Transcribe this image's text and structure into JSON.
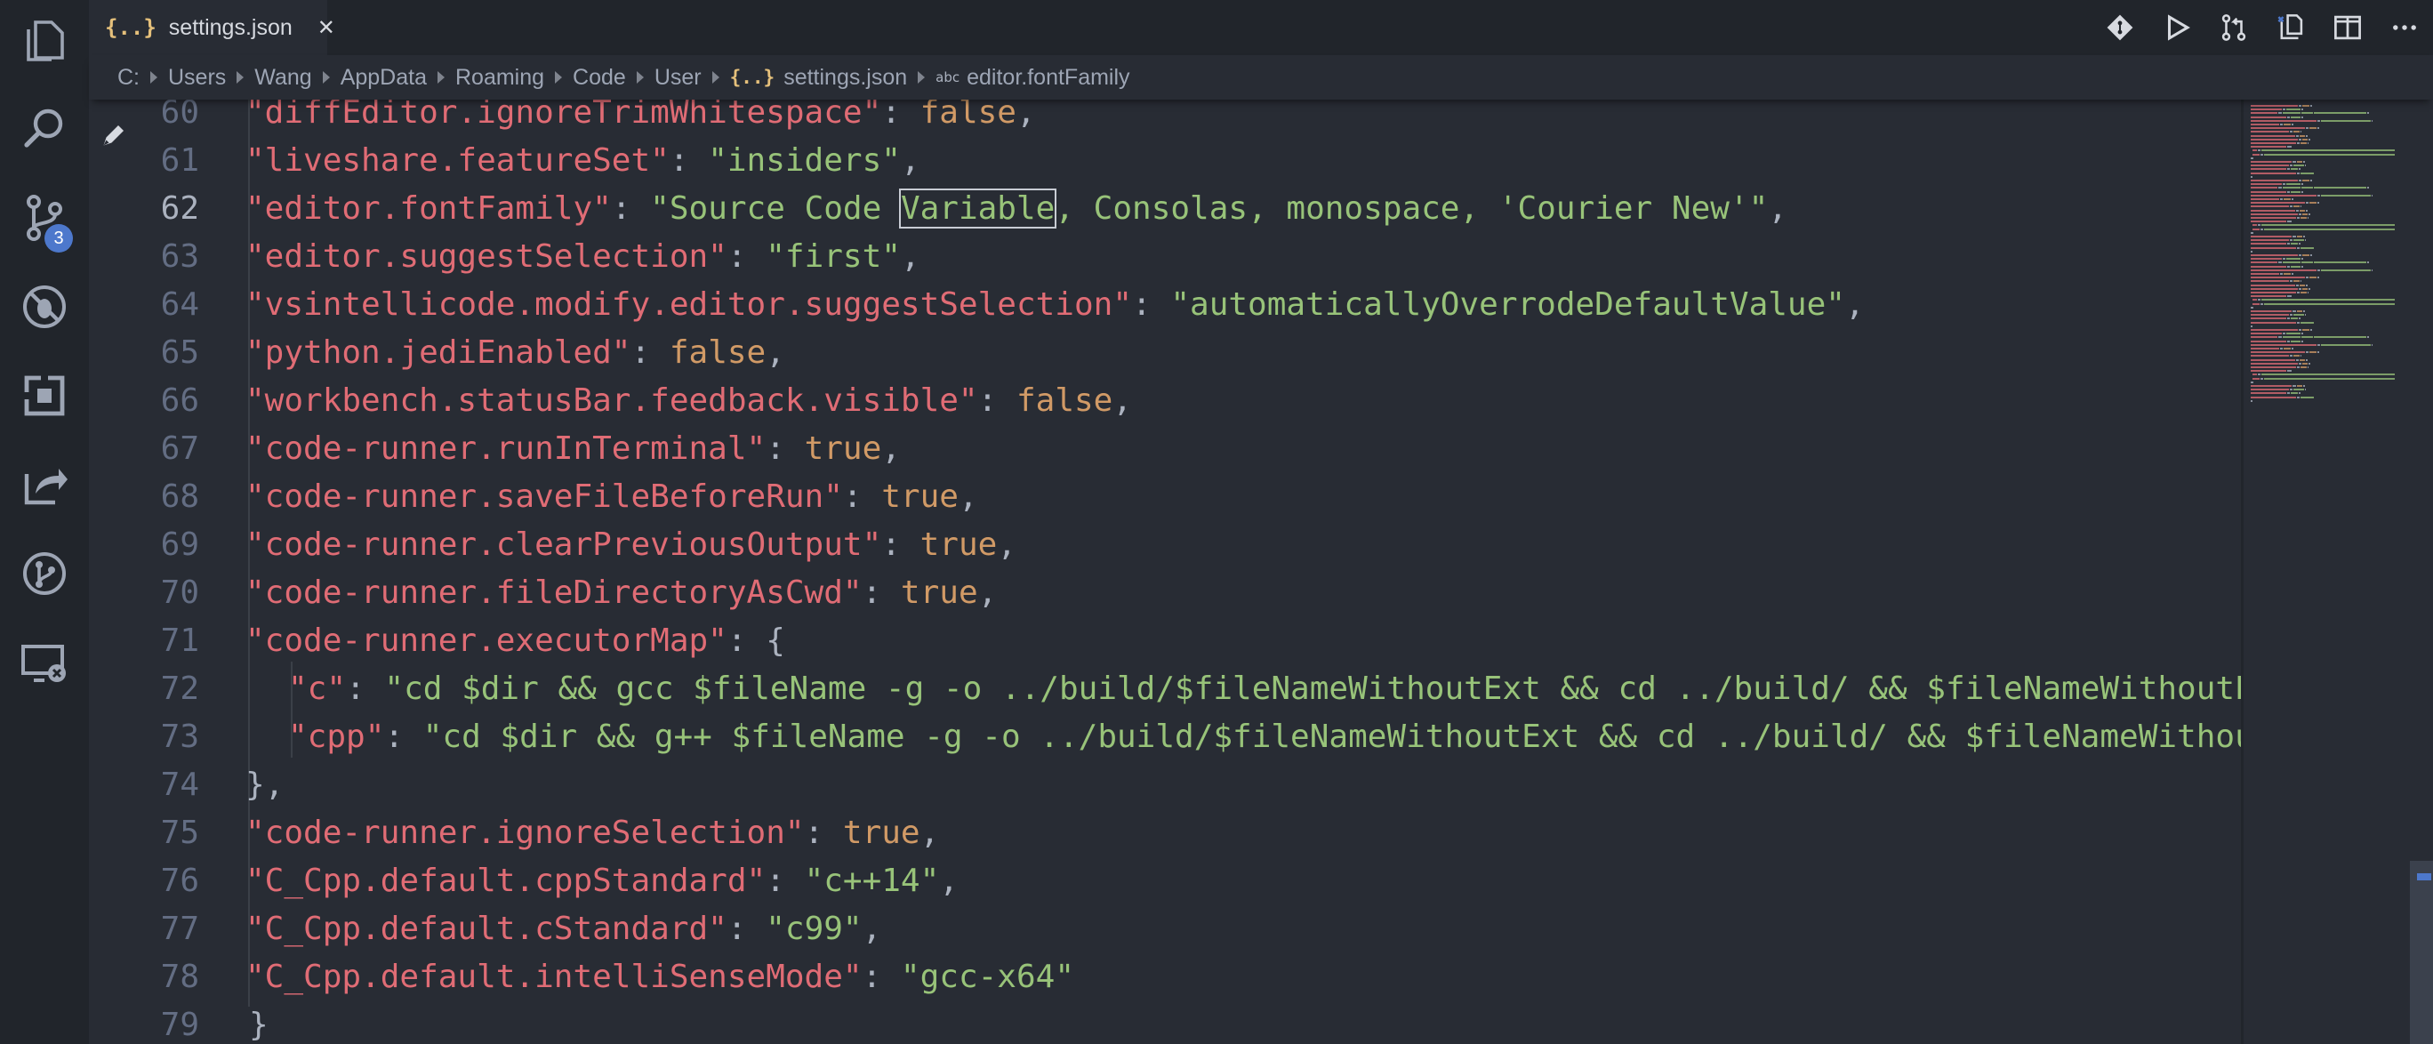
{
  "tab": {
    "icon": "json-braces-icon",
    "glyph": "{..}",
    "label": "settings.json",
    "close_glyph": "✕"
  },
  "breadcrumb": {
    "segments": [
      "C:",
      "Users",
      "Wang",
      "AppData",
      "Roaming",
      "Code",
      "User",
      "settings.json",
      "editor.fontFamily"
    ],
    "json_glyph": "{..}",
    "abc_glyph": "abc"
  },
  "activity_bar": {
    "items": [
      {
        "name": "explorer-icon"
      },
      {
        "name": "search-icon"
      },
      {
        "name": "source-control-icon"
      },
      {
        "name": "debug-icon"
      },
      {
        "name": "extensions-icon"
      },
      {
        "name": "live-share-icon"
      },
      {
        "name": "git-graph-icon"
      },
      {
        "name": "remote-explorer-icon"
      }
    ],
    "scm_badge": "3"
  },
  "editor_actions": [
    "git-compare-icon",
    "run-icon",
    "pull-request-icon",
    "open-changes-icon",
    "split-editor-icon",
    "more-actions-icon"
  ],
  "editor": {
    "current_line": "62",
    "lines": [
      {
        "num": "60",
        "tokens": [
          {
            "t": "k",
            "v": "\"diffEditor.ignoreTrimWhitespace\""
          },
          {
            "t": "p",
            "v": ": "
          },
          {
            "t": "n",
            "v": "false"
          },
          {
            "t": "p",
            "v": ","
          }
        ]
      },
      {
        "num": "61",
        "tokens": [
          {
            "t": "k",
            "v": "\"liveshare.featureSet\""
          },
          {
            "t": "p",
            "v": ": "
          },
          {
            "t": "s",
            "v": "\"insiders\""
          },
          {
            "t": "p",
            "v": ","
          }
        ]
      },
      {
        "num": "62",
        "tokens": [
          {
            "t": "k",
            "v": "\"editor.fontFamily\""
          },
          {
            "t": "p",
            "v": ": "
          },
          {
            "t": "s",
            "v": "\"Source Code "
          },
          {
            "t": "hl",
            "v": "Variable"
          },
          {
            "t": "s",
            "v": ", Consolas, monospace, 'Courier New'\""
          },
          {
            "t": "p",
            "v": ","
          }
        ]
      },
      {
        "num": "63",
        "tokens": [
          {
            "t": "k",
            "v": "\"editor.suggestSelection\""
          },
          {
            "t": "p",
            "v": ": "
          },
          {
            "t": "s",
            "v": "\"first\""
          },
          {
            "t": "p",
            "v": ","
          }
        ]
      },
      {
        "num": "64",
        "tokens": [
          {
            "t": "k",
            "v": "\"vsintellicode.modify.editor.suggestSelection\""
          },
          {
            "t": "p",
            "v": ": "
          },
          {
            "t": "s",
            "v": "\"automaticallyOverrodeDefaultValue\""
          },
          {
            "t": "p",
            "v": ","
          }
        ]
      },
      {
        "num": "65",
        "tokens": [
          {
            "t": "k",
            "v": "\"python.jediEnabled\""
          },
          {
            "t": "p",
            "v": ": "
          },
          {
            "t": "n",
            "v": "false"
          },
          {
            "t": "p",
            "v": ","
          }
        ]
      },
      {
        "num": "66",
        "tokens": [
          {
            "t": "k",
            "v": "\"workbench.statusBar.feedback.visible\""
          },
          {
            "t": "p",
            "v": ": "
          },
          {
            "t": "n",
            "v": "false"
          },
          {
            "t": "p",
            "v": ","
          }
        ]
      },
      {
        "num": "67",
        "tokens": [
          {
            "t": "k",
            "v": "\"code-runner.runInTerminal\""
          },
          {
            "t": "p",
            "v": ": "
          },
          {
            "t": "n",
            "v": "true"
          },
          {
            "t": "p",
            "v": ","
          }
        ]
      },
      {
        "num": "68",
        "tokens": [
          {
            "t": "k",
            "v": "\"code-runner.saveFileBeforeRun\""
          },
          {
            "t": "p",
            "v": ": "
          },
          {
            "t": "n",
            "v": "true"
          },
          {
            "t": "p",
            "v": ","
          }
        ]
      },
      {
        "num": "69",
        "tokens": [
          {
            "t": "k",
            "v": "\"code-runner.clearPreviousOutput\""
          },
          {
            "t": "p",
            "v": ": "
          },
          {
            "t": "n",
            "v": "true"
          },
          {
            "t": "p",
            "v": ","
          }
        ]
      },
      {
        "num": "70",
        "tokens": [
          {
            "t": "k",
            "v": "\"code-runner.fileDirectoryAsCwd\""
          },
          {
            "t": "p",
            "v": ": "
          },
          {
            "t": "n",
            "v": "true"
          },
          {
            "t": "p",
            "v": ","
          }
        ]
      },
      {
        "num": "71",
        "tokens": [
          {
            "t": "k",
            "v": "\"code-runner.executorMap\""
          },
          {
            "t": "p",
            "v": ": {"
          }
        ]
      },
      {
        "num": "72",
        "indent": "  ",
        "tokens": [
          {
            "t": "k",
            "v": "\"c\""
          },
          {
            "t": "p",
            "v": ": "
          },
          {
            "t": "s",
            "v": "\"cd $dir && gcc $fileName -g -o ../build/$fileNameWithoutExt && cd ../build/ && $fileNameWithoutExt\""
          }
        ]
      },
      {
        "num": "73",
        "indent": "  ",
        "tokens": [
          {
            "t": "k",
            "v": "\"cpp\""
          },
          {
            "t": "p",
            "v": ": "
          },
          {
            "t": "s",
            "v": "\"cd $dir && g++ $fileName -g -o ../build/$fileNameWithoutExt && cd ../build/ && $fileNameWithoutExt\""
          }
        ]
      },
      {
        "num": "74",
        "tokens": [
          {
            "t": "p",
            "v": "},"
          }
        ]
      },
      {
        "num": "75",
        "tokens": [
          {
            "t": "k",
            "v": "\"code-runner.ignoreSelection\""
          },
          {
            "t": "p",
            "v": ": "
          },
          {
            "t": "n",
            "v": "true"
          },
          {
            "t": "p",
            "v": ","
          }
        ]
      },
      {
        "num": "76",
        "tokens": [
          {
            "t": "k",
            "v": "\"C_Cpp.default.cppStandard\""
          },
          {
            "t": "p",
            "v": ": "
          },
          {
            "t": "s",
            "v": "\"c++14\""
          },
          {
            "t": "p",
            "v": ","
          }
        ]
      },
      {
        "num": "77",
        "tokens": [
          {
            "t": "k",
            "v": "\"C_Cpp.default.cStandard\""
          },
          {
            "t": "p",
            "v": ": "
          },
          {
            "t": "s",
            "v": "\"c99\""
          },
          {
            "t": "p",
            "v": ","
          }
        ]
      },
      {
        "num": "78",
        "tokens": [
          {
            "t": "k",
            "v": "\"C_Cpp.default.intelliSenseMode\""
          },
          {
            "t": "p",
            "v": ": "
          },
          {
            "t": "s",
            "v": "\"gcc-x64\""
          }
        ]
      },
      {
        "num": "79",
        "root": true,
        "tokens": [
          {
            "t": "p",
            "v": "}"
          }
        ]
      }
    ]
  },
  "colors": {
    "background": "#282c34",
    "sidebar": "#21252b",
    "key": "#e06c75",
    "string": "#98c379",
    "literal": "#d19a66",
    "punctuation": "#abb2bf",
    "line_number": "#636d83",
    "badge": "#4d78cc"
  }
}
